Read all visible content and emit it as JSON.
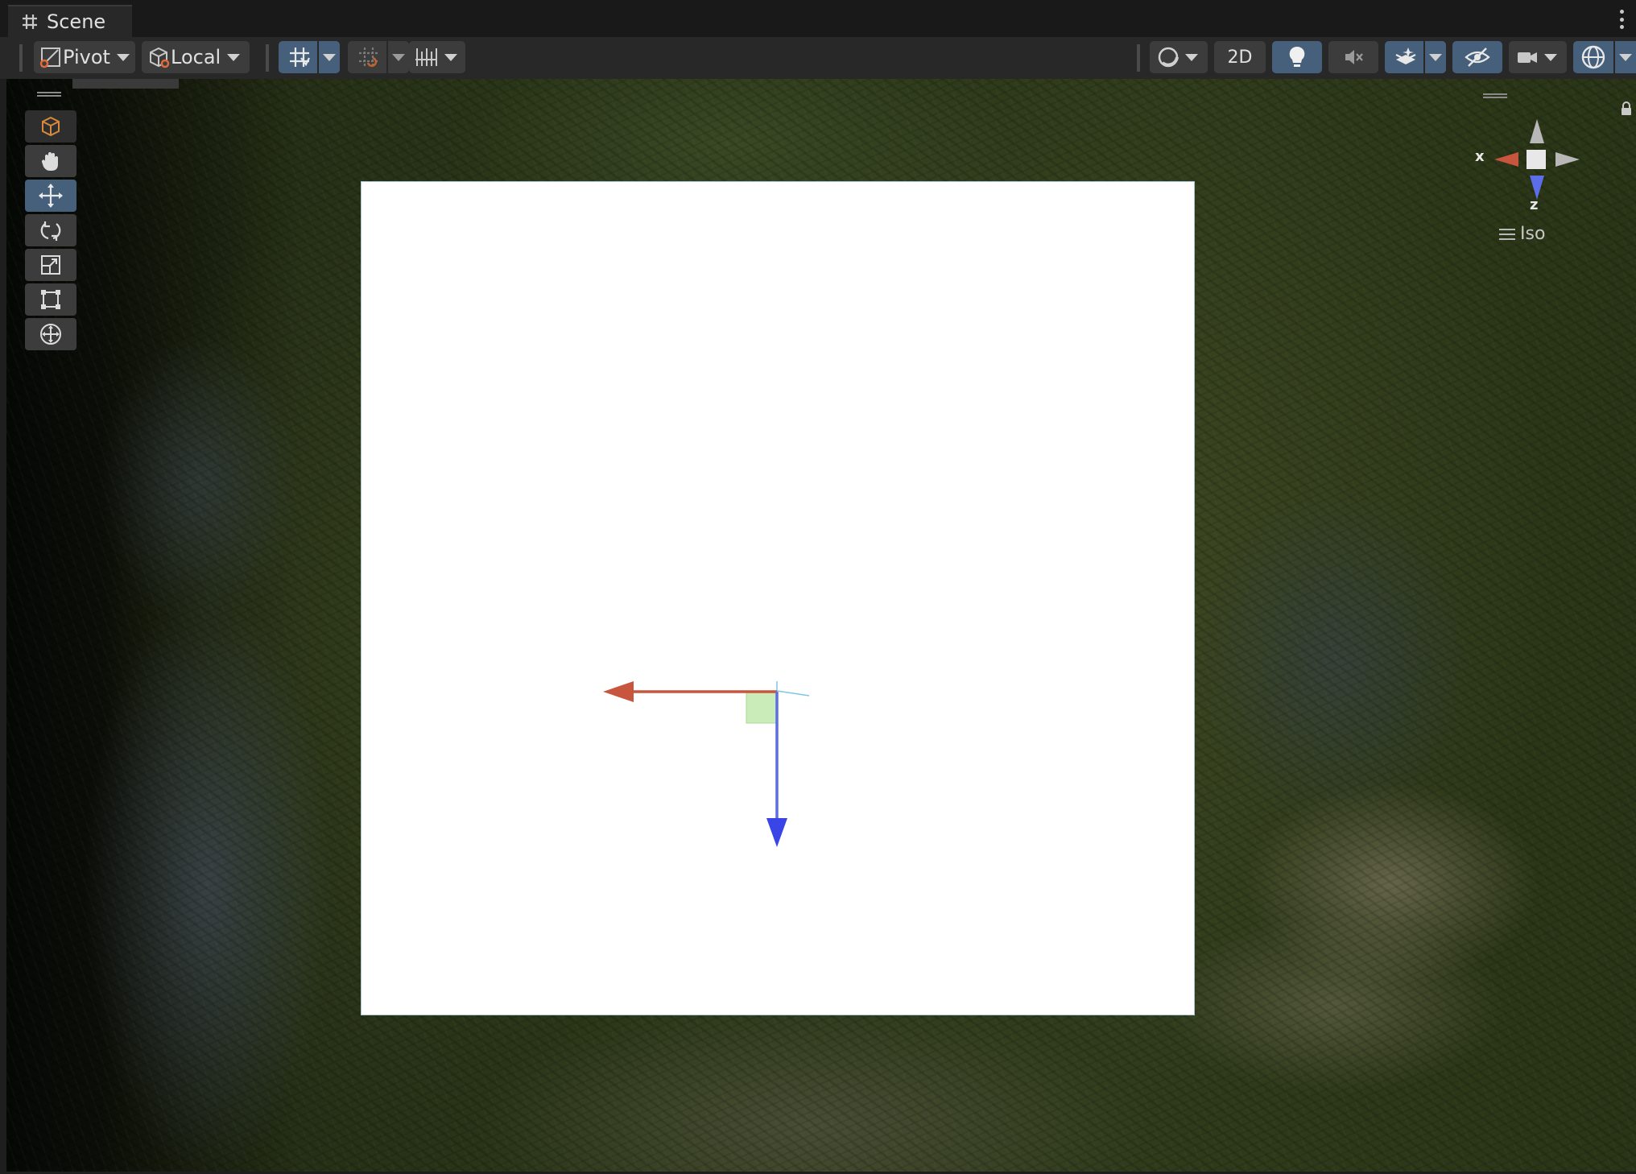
{
  "window": {
    "tab_title": "Scene",
    "tab_icon": "grid-icon",
    "menu_icon": "kebab-menu-icon"
  },
  "toolbar": {
    "pivot_label": "Pivot",
    "local_label": "Local",
    "mode_2d_label": "2D",
    "icons": {
      "pivot": "pivot-icon",
      "local": "local-cube-icon",
      "grid_snap": "grid-snap-icon",
      "increment_snap": "increment-snap-icon",
      "ruler": "ruler-grid-icon",
      "draw_mode": "shading-sphere-icon",
      "lighting": "light-bulb-icon",
      "audio": "audio-mute-icon",
      "effects": "effects-layers-icon",
      "visibility": "hidden-eye-icon",
      "camera": "camera-icon",
      "gizmos": "gizmos-globe-icon"
    },
    "active_color": "#46607c",
    "button_color": "#3c3c3c"
  },
  "tools": {
    "items": [
      {
        "id": "view-tool",
        "icon": "hand-icon",
        "active": false
      },
      {
        "id": "move-tool",
        "icon": "move-arrows-icon",
        "active": true
      },
      {
        "id": "rotate-tool",
        "icon": "rotate-icon",
        "active": false
      },
      {
        "id": "scale-tool",
        "icon": "scale-icon",
        "active": false
      },
      {
        "id": "rect-tool",
        "icon": "rect-transform-icon",
        "active": false
      },
      {
        "id": "transform-tool",
        "icon": "transform-icon",
        "active": false
      }
    ]
  },
  "orientation_gizmo": {
    "x_label": "x",
    "z_label": "z",
    "projection_label": "Iso",
    "x_color": "#c8553d",
    "z_color": "#5b6ee8"
  },
  "scene": {
    "quad_color": "#ffffff",
    "move_handle_x_color": "#c8553d",
    "move_handle_z_color": "#3a45e8",
    "plane_handle_color": "#b8e6a0"
  }
}
